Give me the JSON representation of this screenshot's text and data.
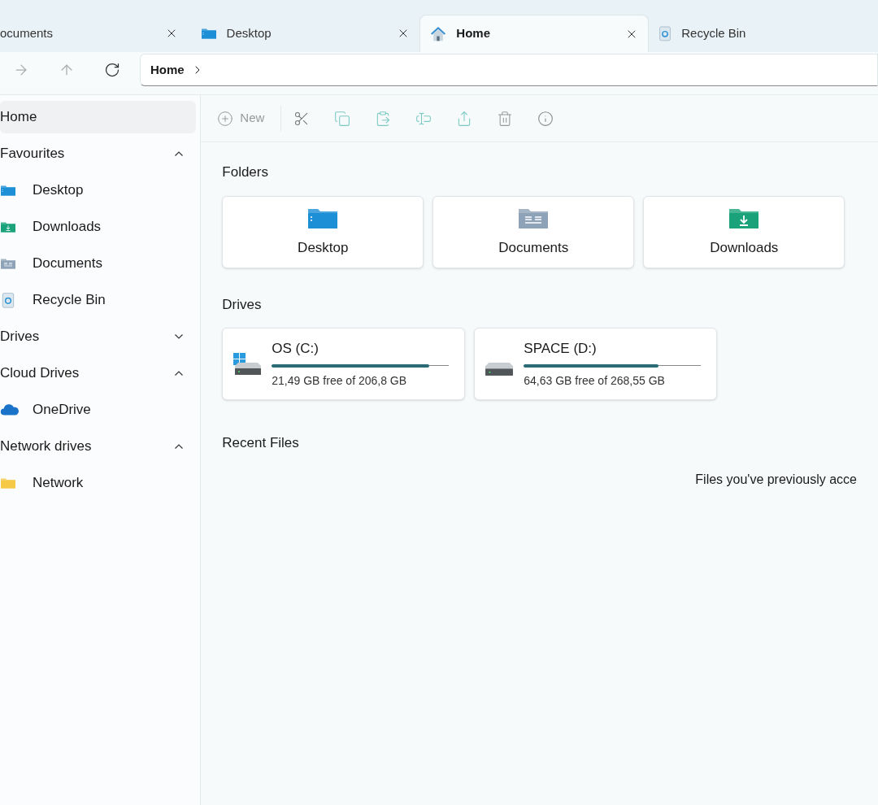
{
  "tabs": [
    {
      "label": "ocuments",
      "selected": false
    },
    {
      "label": "Desktop",
      "selected": false
    },
    {
      "label": "Home",
      "selected": true
    },
    {
      "label": "Recycle Bin",
      "selected": false
    }
  ],
  "address_bar": {
    "crumb": "Home"
  },
  "toolbar": {
    "new_label": "New"
  },
  "sidebar": {
    "items": [
      {
        "kind": "item",
        "label": "Home",
        "selected": true
      },
      {
        "kind": "section",
        "label": "Favourites",
        "expanded": true
      },
      {
        "kind": "item",
        "label": "Desktop",
        "selected": false
      },
      {
        "kind": "item",
        "label": "Downloads",
        "selected": false
      },
      {
        "kind": "item",
        "label": "Documents",
        "selected": false
      },
      {
        "kind": "item",
        "label": "Recycle Bin",
        "selected": false
      },
      {
        "kind": "section",
        "label": "Drives",
        "expanded": false
      },
      {
        "kind": "section",
        "label": "Cloud Drives",
        "expanded": true
      },
      {
        "kind": "item",
        "label": "OneDrive",
        "selected": false
      },
      {
        "kind": "section",
        "label": "Network drives",
        "expanded": true
      },
      {
        "kind": "item",
        "label": "Network",
        "selected": false
      }
    ]
  },
  "folders": {
    "heading": "Folders",
    "items": [
      {
        "label": "Desktop"
      },
      {
        "label": "Documents"
      },
      {
        "label": "Downloads"
      }
    ]
  },
  "drives": {
    "heading": "Drives",
    "items": [
      {
        "name": "OS (C:)",
        "level": 0.89,
        "space": "21,49 GB free of 206,8 GB"
      },
      {
        "name": "SPACE (D:)",
        "level": 0.76,
        "space": "64,63 GB free of 268,55 GB"
      }
    ]
  },
  "recent_files": {
    "heading": "Recent Files",
    "empty_message": "Files you've previously acce"
  }
}
